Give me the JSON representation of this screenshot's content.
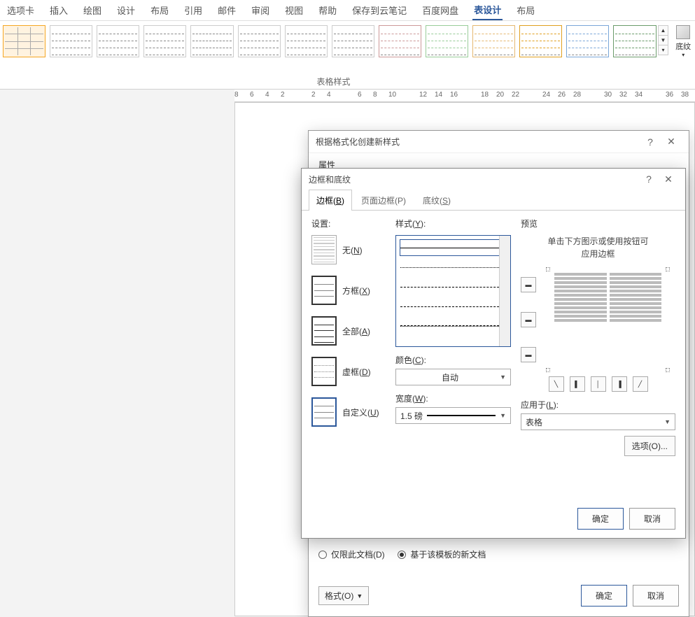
{
  "ribbon": {
    "tabs": [
      "选项卡",
      "插入",
      "绘图",
      "设计",
      "布局",
      "引用",
      "邮件",
      "审阅",
      "视图",
      "帮助",
      "保存到云笔记",
      "百度网盘",
      "表设计",
      "布局"
    ],
    "active_tab": "表设计",
    "group_label": "表格样式",
    "shading_label": "底纹"
  },
  "ruler_marks": [
    8,
    6,
    4,
    2,
    "",
    2,
    4,
    "",
    6,
    8,
    10,
    "",
    12,
    14,
    16,
    "",
    18,
    20,
    22,
    "",
    24,
    26,
    28,
    "",
    30,
    32,
    34,
    "",
    36,
    38
  ],
  "dialog_style": {
    "title": "根据格式化创建新样式",
    "section_props": "属性",
    "radio_doc_only": "仅限此文档(D)",
    "radio_template": "基于该模板的新文档",
    "format_btn": "格式(O)",
    "ok": "确定",
    "cancel": "取消"
  },
  "dialog_border": {
    "title": "边框和底纹",
    "tabs": {
      "border": "边框(B)",
      "page": "页面边框(P)",
      "shading": "底纹(S)"
    },
    "settings_label": "设置:",
    "settings": {
      "none": "无(N)",
      "box": "方框(X)",
      "all": "全部(A)",
      "grid": "虚框(D)",
      "custom": "自定义(U)"
    },
    "style_label": "样式(Y):",
    "color_label": "颜色(C):",
    "color_value": "自动",
    "width_label": "宽度(W):",
    "width_value": "1.5 磅",
    "preview_label": "预览",
    "preview_hint1": "单击下方图示或使用按钮可",
    "preview_hint2": "应用边框",
    "apply_label": "应用于(L):",
    "apply_value": "表格",
    "options_btn": "选项(O)...",
    "ok": "确定",
    "cancel": "取消"
  }
}
